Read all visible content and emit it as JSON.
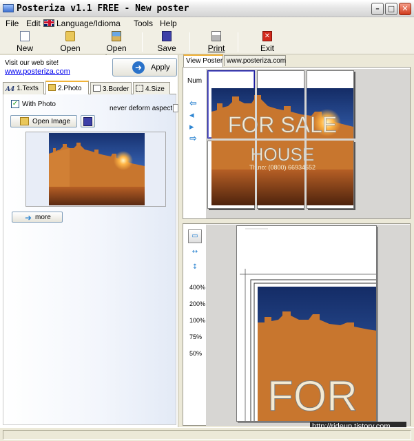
{
  "window": {
    "title": "Posteriza v1.1 FREE - New poster"
  },
  "menu": {
    "file": "File",
    "edit": "Edit",
    "language": "Language/Idioma",
    "tools": "Tools",
    "help": "Help"
  },
  "toolbar": {
    "new": "New",
    "open": "Open",
    "open_image": "Open Image",
    "save": "Save",
    "print": "Print",
    "exit": "Exit"
  },
  "left": {
    "visit_text": "Visit our web site!",
    "visit_link": "www.posteriza.com",
    "apply": "Apply",
    "tabs": [
      "1.Texts",
      "2.Photo",
      "3.Border",
      "4.Size"
    ],
    "active_tab": "2.Photo",
    "with_photo_label": "With Photo",
    "with_photo_checked": true,
    "deform_label": "never deform aspect",
    "open_image_button": "Open Image",
    "more_button": "more"
  },
  "right": {
    "tabs": [
      "View Poster",
      "www.posteriza.com"
    ],
    "num_label": "Num",
    "poster_text_line1": "FOR SALE",
    "poster_text_line2": "HOUSE",
    "poster_text_line3": "Tlf.no: (0800) 66934552",
    "zoom_levels": [
      "400%",
      "200%",
      "100%",
      "75%",
      "50%"
    ],
    "preview_text": "FOR"
  },
  "watermark": "http://rideup.tistory.com",
  "colors": {
    "sky": "#1b3d8f",
    "wall": "#c8762e",
    "tab_highlight": "#f1b338",
    "link": "#0000ee"
  }
}
